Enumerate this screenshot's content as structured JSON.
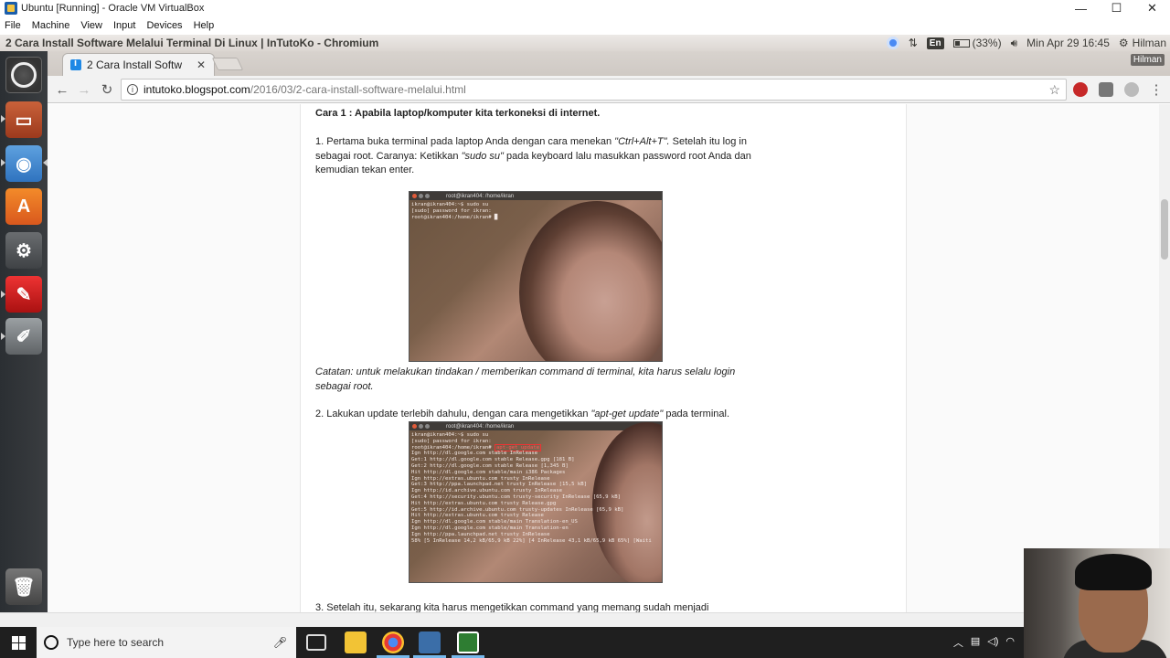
{
  "vbox": {
    "title": "Ubuntu [Running] - Oracle VM VirtualBox",
    "menu": [
      "File",
      "Machine",
      "View",
      "Input",
      "Devices",
      "Help"
    ],
    "controls": [
      "—",
      "☐",
      "✕"
    ]
  },
  "ubuntu_panel": {
    "window_title": "2 Cara Install Software Melalui Terminal Di Linux | InTutoKo - Chromium",
    "keyboard": "En",
    "battery": "(33%)",
    "clock": "Min Apr 29 16:45",
    "user": "Hilman"
  },
  "launcher": {
    "items": [
      "dash-home",
      "files",
      "chromium",
      "ubuntu-software",
      "system-settings",
      "libreoffice-writer",
      "text-editor",
      "trash"
    ]
  },
  "browser": {
    "tab_title": "2 Cara Install Software Melalui Terminal Di Linux | InTutoKo",
    "tab_label_visible": "2 Cara Install Softw",
    "profile": "Hilman",
    "url_host": "intutoko.blogspot.com",
    "url_path": "/2016/03/2-cara-install-software-melalui.html"
  },
  "article": {
    "heading": "Cara 1 : Apabila laptop/komputer kita terkoneksi di internet.",
    "step1_a": "1. Pertama buka terminal pada laptop Anda dengan cara menekan ",
    "step1_key": "\"Ctrl+Alt+T\".",
    "step1_b": "  Setelah itu log in sebagai root. Caranya: Ketikkan ",
    "step1_cmd": "\"sudo su\"",
    "step1_c": " pada keyboard lalu masukkan password root Anda dan kemudian tekan enter.",
    "screenshot1": {
      "window_title": "root@ikran404: /home/ikran",
      "lines": [
        "ikran@ikran404:~$ sudo su",
        "[sudo] password for ikran:",
        "root@ikran404:/home/ikran# █"
      ]
    },
    "note": "Catatan: untuk melakukan tindakan / memberikan command di terminal, kita harus selalu login sebagai root.",
    "step2_a": "2. Lakukan update terlebih dahulu, dengan cara mengetikkan ",
    "step2_cmd": "\"apt-get update\"",
    "step2_b": " pada terminal.",
    "screenshot2": {
      "window_title": "root@ikran404: /home/ikran",
      "prompt_prefix": "root@ikran404:/home/ikran# ",
      "highlight_cmd": "apt-get update",
      "lines": [
        "ikran@ikran404:~$ sudo su",
        "[sudo] password for ikran:",
        "Ign http://dl.google.com stable InRelease",
        "Get:1 http://dl.google.com stable Release.gpg [181 B]",
        "Get:2 http://dl.google.com stable Release [1,345 B]",
        "Hit http://dl.google.com stable/main i386 Packages",
        "Ign http://extras.ubuntu.com trusty InRelease",
        "Get:3 http://ppa.launchpad.net trusty InRelease [15,5 kB]",
        "Ign http://id.archive.ubuntu.com trusty InRelease",
        "Get:4 http://security.ubuntu.com trusty-security InRelease [65,9 kB]",
        "Hit http://extras.ubuntu.com trusty Release.gpg",
        "Get:5 http://id.archive.ubuntu.com trusty-updates InRelease [65,9 kB]",
        "Hit http://extras.ubuntu.com trusty Release",
        "Ign http://dl.google.com stable/main Translation-en_US",
        "Ign http://dl.google.com stable/main Translation-en",
        "Ign http://ppa.launchpad.net trusty InRelease",
        "58% [5 InRelease 14,2 kB/65,9 kB 22%] [4 InRelease 43,1 kB/65,9 kB 65%] [Waiti"
      ]
    },
    "step3": "3. Setelah itu, sekarang kita harus mengetikkan command yang memang sudah menjadi"
  },
  "taskbar": {
    "search_placeholder": "Type here to search"
  },
  "colors": {
    "launcher_bg": "#2b2f33",
    "taskbar_bg": "#1f1f1f",
    "panel_bg": "#dcd7d2"
  }
}
